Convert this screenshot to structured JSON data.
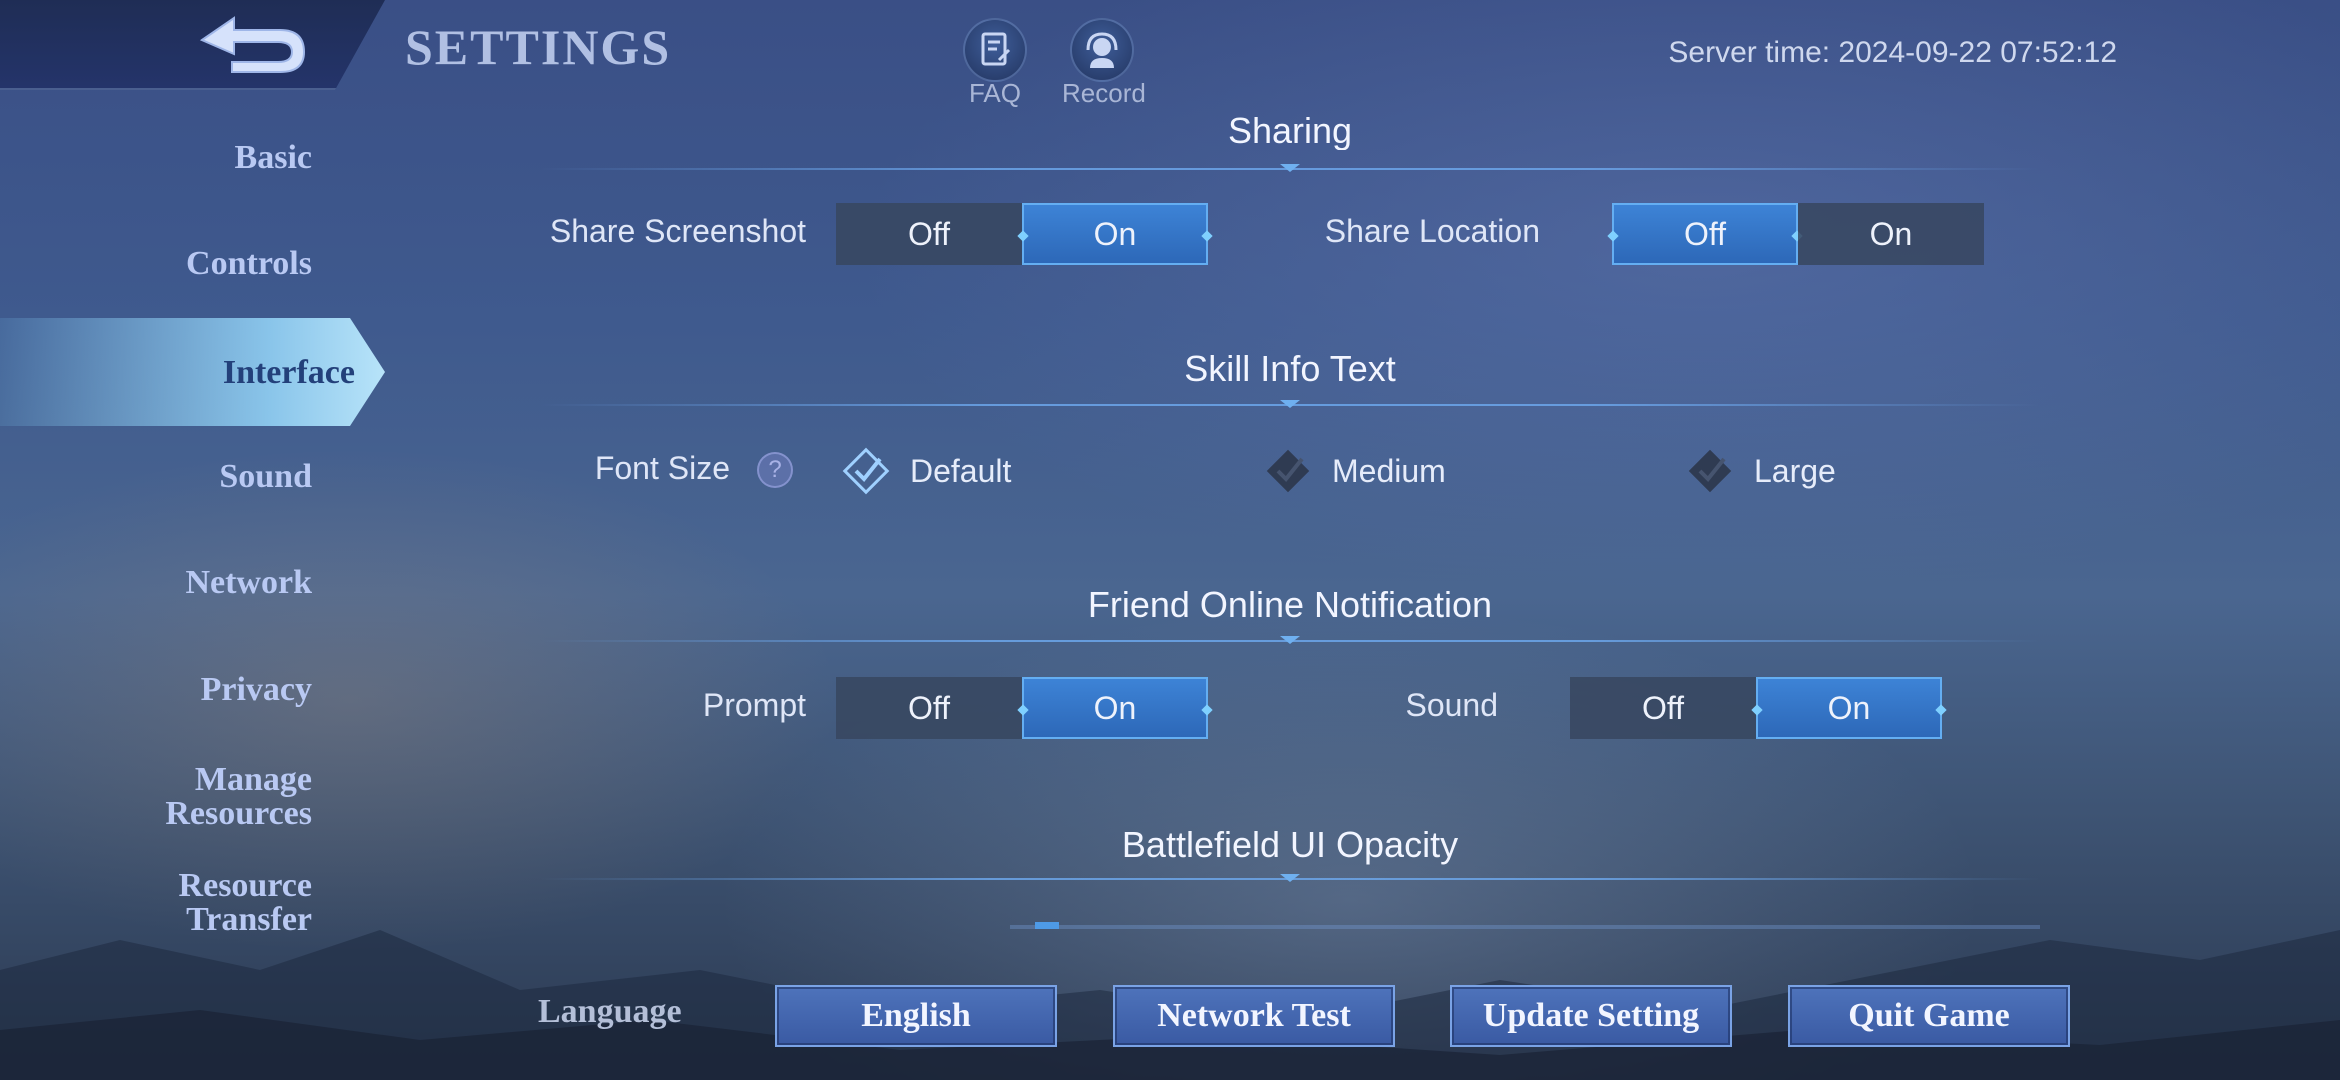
{
  "header": {
    "title": "SETTINGS",
    "faq_label": "FAQ",
    "record_label": "Record",
    "server_time": "Server time: 2024-09-22 07:52:12"
  },
  "sidebar": {
    "active": "Interface",
    "items": [
      "Basic",
      "Controls",
      "Interface",
      "Sound",
      "Network",
      "Privacy",
      "Manage Resources",
      "Resource Transfer"
    ]
  },
  "sharing": {
    "title": "Sharing",
    "screenshot_label": "Share Screenshot",
    "screenshot_off": "Off",
    "screenshot_on": "On",
    "screenshot_value": "On",
    "location_label": "Share Location",
    "location_off": "Off",
    "location_on": "On",
    "location_value": "Off"
  },
  "skill_info": {
    "title": "Skill Info Text",
    "font_size_label": "Font Size",
    "help": "?",
    "options": [
      "Default",
      "Medium",
      "Large"
    ],
    "selected": "Default"
  },
  "friend_notification": {
    "title": "Friend Online Notification",
    "prompt_label": "Prompt",
    "prompt_off": "Off",
    "prompt_on": "On",
    "prompt_value": "On",
    "sound_label": "Sound",
    "sound_off": "Off",
    "sound_on": "On",
    "sound_value": "On"
  },
  "battlefield_ui": {
    "title": "Battlefield UI Opacity",
    "opacity_fraction": 0.02
  },
  "footer": {
    "language_label": "Language",
    "language_button": "English",
    "network_test": "Network Test",
    "update_setting": "Update Setting",
    "quit_game": "Quit Game"
  },
  "colors": {
    "accent": "#3d83d6",
    "selected_border": "#64aef2",
    "sidebar_text": "#b9c9f3",
    "active_tab_text": "#23407a"
  }
}
